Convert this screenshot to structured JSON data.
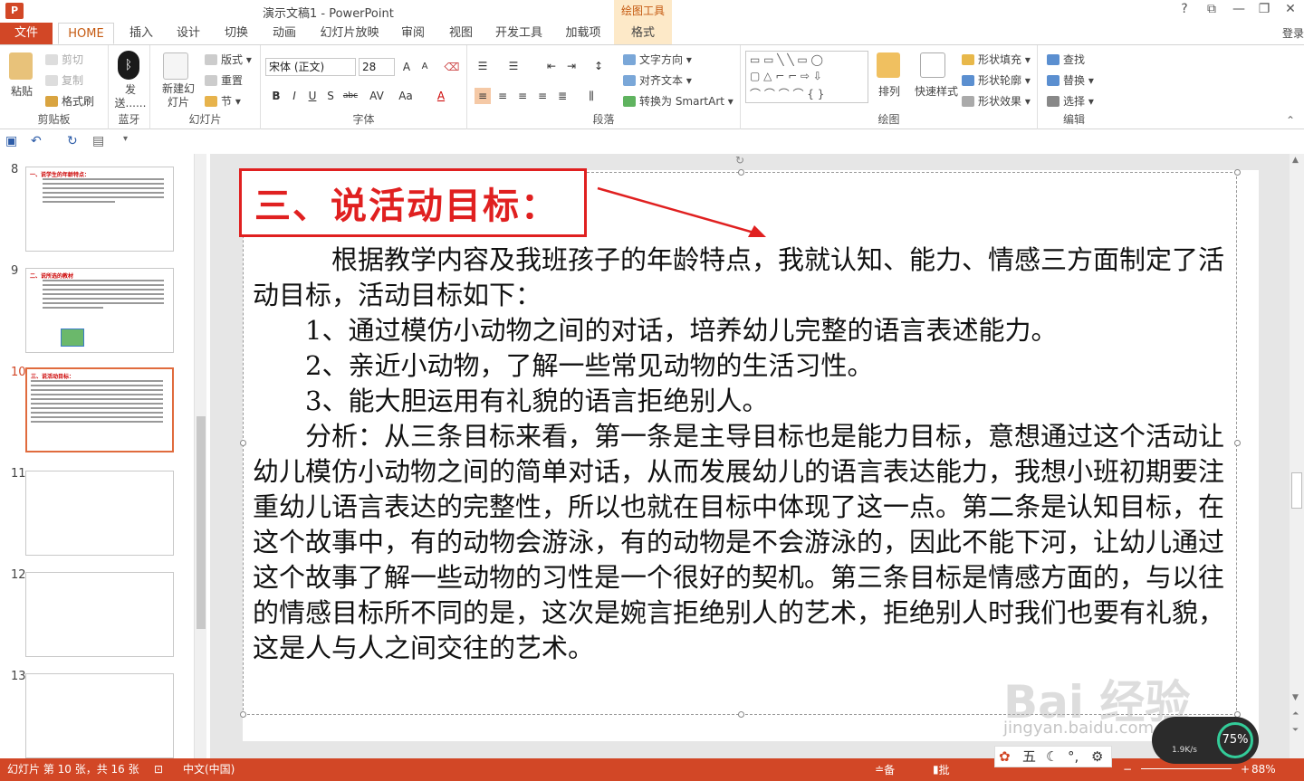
{
  "window": {
    "title": "演示文稿1 - PowerPoint",
    "context_tool": "绘图工具",
    "help": "?",
    "controls": [
      "⧉",
      "—",
      "❐",
      "✕"
    ]
  },
  "tabs": [
    "文件",
    "HOME",
    "插入",
    "设计",
    "切换",
    "动画",
    "幻灯片放映",
    "审阅",
    "视图",
    "开发工具",
    "加载项",
    "格式"
  ],
  "login": "登录",
  "ribbon": {
    "clipboard": {
      "label": "剪贴板",
      "paste": "粘贴",
      "cut": "剪切",
      "copy": "复制",
      "format_painter": "格式刷"
    },
    "bluetooth": {
      "label": "蓝牙",
      "send": "发送......"
    },
    "slides": {
      "label": "幻灯片",
      "new_slide": "新建幻灯片",
      "layout": "版式",
      "reset": "重置",
      "section": "节"
    },
    "font": {
      "label": "字体",
      "font_name": "宋体 (正文)",
      "font_size": "28"
    },
    "paragraph": {
      "label": "段落",
      "text_direction": "文字方向",
      "align_text": "对齐文本",
      "smartart": "转换为 SmartArt"
    },
    "drawing": {
      "label": "绘图",
      "arrange": "排列",
      "quick_styles": "快速样式",
      "shape_fill": "形状填充",
      "shape_outline": "形状轮廓",
      "shape_effects": "形状效果"
    },
    "editing": {
      "label": "编辑",
      "find": "查找",
      "replace": "替换",
      "select": "选择"
    }
  },
  "thumbnails": [
    {
      "num": "8",
      "title": "一、说学生的年龄特点：",
      "selected": false
    },
    {
      "num": "9",
      "title": "二、说所选的教材",
      "selected": false
    },
    {
      "num": "10",
      "title": "三、说活动目标：",
      "selected": true
    },
    {
      "num": "11",
      "title": "",
      "selected": false
    },
    {
      "num": "12",
      "title": "",
      "selected": false
    },
    {
      "num": "13",
      "title": "",
      "selected": false
    }
  ],
  "slide": {
    "title": "三、说活动目标：",
    "body": [
      "　　　根据教学内容及我班孩子的年龄特点，我就认知、能力、情感三方面制定了活动目标，活动目标如下：",
      "　　1、通过模仿小动物之间的对话，培养幼儿完整的语言表述能力。",
      "　　2、亲近小动物，了解一些常见动物的生活习性。",
      "　　3、能大胆运用有礼貌的语言拒绝别人。",
      "　　分析：从三条目标来看，第一条是主导目标也是能力目标，意想通过这个活动让幼儿模仿小动物之间的简单对话，从而发展幼儿的语言表达能力，我想小班初期要注重幼儿语言表达的完整性，所以也就在目标中体现了这一点。第二条是认知目标，在这个故事中，有的动物会游泳，有的动物是不会游泳的，因此不能下河，让幼儿通过这个故事了解一些动物的习性是一个很好的契机。第三条目标是情感方面的，与以往的情感目标所不同的是，这次是婉言拒绝别人的艺术，拒绝别人时我们也要有礼貌，这是人与人之间交往的艺术。"
    ]
  },
  "statusbar": {
    "slide_info": "幻灯片 第 10 张，共 16 张",
    "language": "中文(中国)",
    "notes": "备注",
    "comments": "批注",
    "zoom": "88%"
  },
  "overlay": {
    "ime": "五",
    "speed_pct": "75%",
    "speed_rate": "1.9K/s",
    "watermark": "Bai 经验",
    "watermark_url": "jingyan.baidu.com"
  },
  "colors": {
    "accent": "#d24726",
    "title_red": "#e02020",
    "context": "#fde9c8"
  }
}
